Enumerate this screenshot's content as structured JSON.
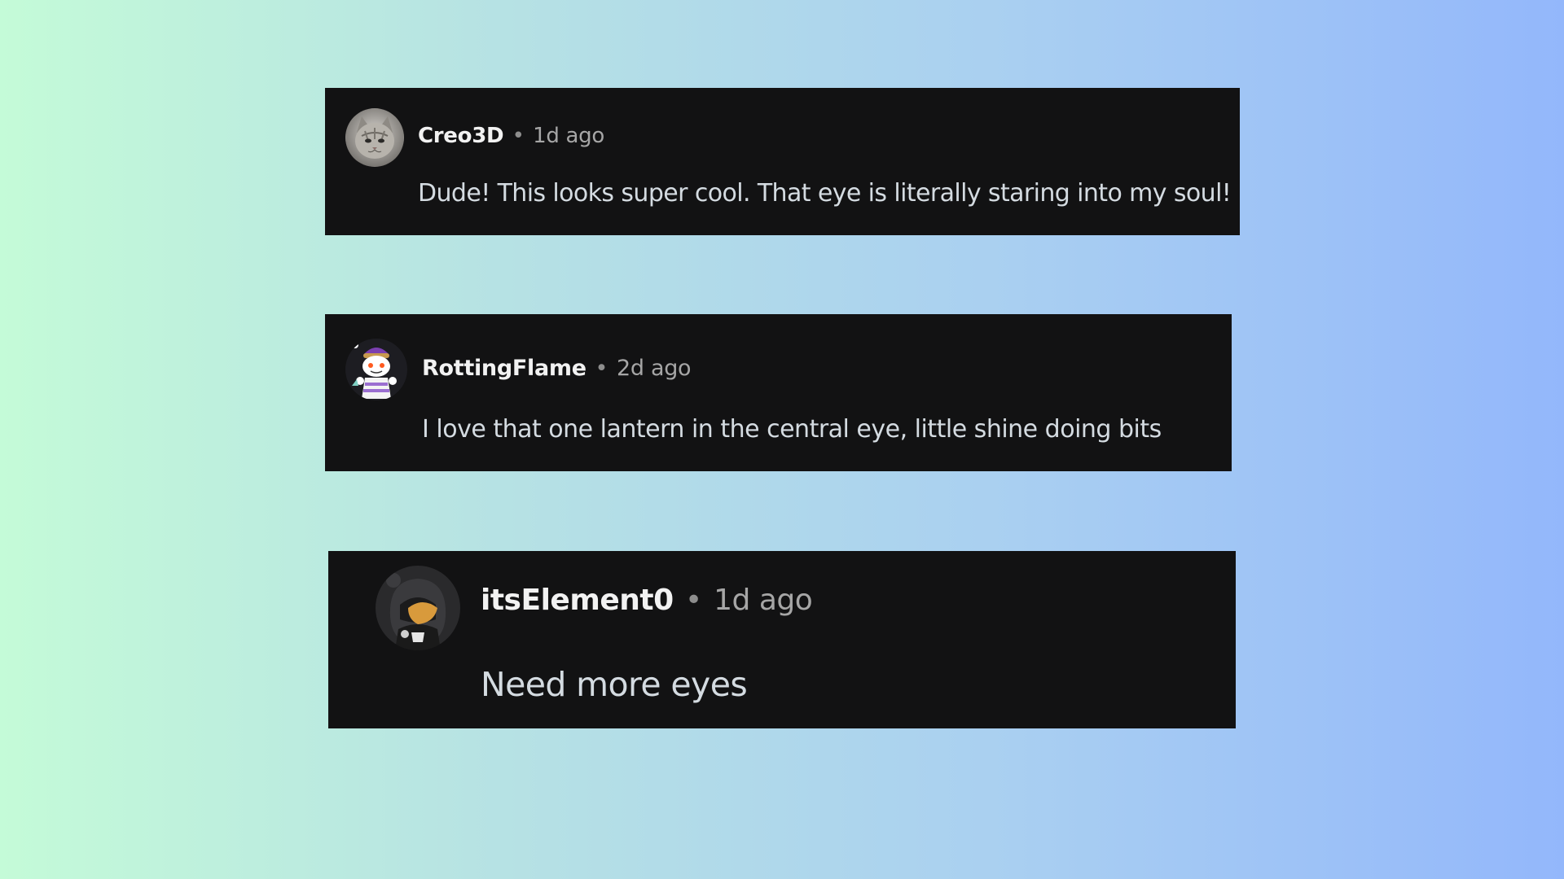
{
  "comments": [
    {
      "username": "Creo3D",
      "separator": "•",
      "timestamp": "1d ago",
      "text": "Dude! This looks super cool. That eye is literally staring into my soul!",
      "avatar_icon": "cat-avatar-icon"
    },
    {
      "username": "RottingFlame",
      "separator": "•",
      "timestamp": "2d ago",
      "text": "I love that one lantern in the central eye, little shine doing bits",
      "avatar_icon": "snoo-avatar-icon"
    },
    {
      "username": "itsElement0",
      "separator": "•",
      "timestamp": "1d ago",
      "text": "Need more eyes",
      "avatar_icon": "hooded-character-avatar-icon"
    }
  ],
  "colors": {
    "card_background": "#121213",
    "username": "#f2f2f2",
    "timestamp": "#a6a6a6",
    "body_text": "#d4dbe1",
    "gradient_start": "#c4fbd8",
    "gradient_end": "#93b7fb"
  }
}
